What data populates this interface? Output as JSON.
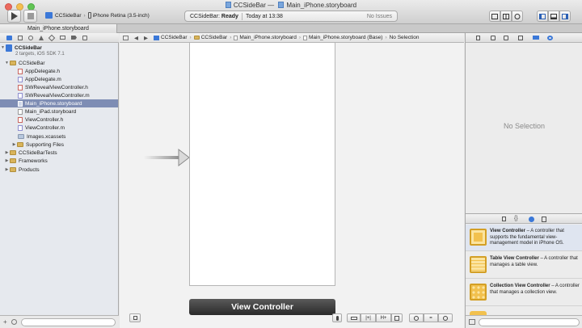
{
  "window": {
    "title_app": "CCSideBar",
    "title_sep": "—",
    "title_file": "Main_iPhone.storyboard",
    "tab": "Main_iPhone.storyboard"
  },
  "toolbar": {
    "scheme": "CCSideBar",
    "destination": "iPhone Retina (3.5-inch)",
    "status_app": "CCSideBar:",
    "status_state": "Ready",
    "status_time": "Today at 13:38",
    "status_issues": "No Issues"
  },
  "navigator": {
    "items": [
      {
        "label": "CCSideBar",
        "type": "project",
        "indent": 0
      },
      {
        "label": "2 targets, iOS SDK 7.1",
        "type": "subtitle",
        "indent": 0
      },
      {
        "label": "CCSideBar",
        "type": "folder-open",
        "indent": 1
      },
      {
        "label": "AppDelegate.h",
        "type": "file",
        "indent": 2
      },
      {
        "label": "AppDelegate.m",
        "type": "file",
        "indent": 2
      },
      {
        "label": "SWRevealViewController.h",
        "type": "file",
        "indent": 2
      },
      {
        "label": "SWRevealViewController.m",
        "type": "file",
        "indent": 2
      },
      {
        "label": "Main_iPhone.storyboard",
        "type": "file",
        "indent": 2,
        "selected": true
      },
      {
        "label": "Main_iPad.storyboard",
        "type": "file",
        "indent": 2
      },
      {
        "label": "ViewController.h",
        "type": "file",
        "indent": 2
      },
      {
        "label": "ViewController.m",
        "type": "file",
        "indent": 2
      },
      {
        "label": "Images.xcassets",
        "type": "file",
        "indent": 2
      },
      {
        "label": "Supporting Files",
        "type": "folder",
        "indent": 2
      },
      {
        "label": "CCSideBarTests",
        "type": "folder",
        "indent": 1
      },
      {
        "label": "Frameworks",
        "type": "folder",
        "indent": 1
      },
      {
        "label": "Products",
        "type": "folder",
        "indent": 1
      }
    ]
  },
  "jumpbar": {
    "crumbs": [
      "CCSideBar",
      "CCSideBar",
      "Main_iPhone.storyboard",
      "Main_iPhone.storyboard (Base)",
      "No Selection"
    ]
  },
  "canvas": {
    "scene_label": "View Controller"
  },
  "inspector": {
    "empty_text": "No Selection"
  },
  "library": {
    "items": [
      {
        "title": "View Controller",
        "desc": " – A controller that supports the fundamental view-management model in iPhone OS.",
        "color": "#f2c14e"
      },
      {
        "title": "Table View Controller",
        "desc": " – A controller that manages a table view.",
        "color": "#f2c14e"
      },
      {
        "title": "Collection View Controller",
        "desc": " – A controller that manages a collection view.",
        "color": "#f2c14e"
      }
    ]
  },
  "colors": {
    "selection": "#7e8db4",
    "scene_bar": "#3a3a3a",
    "accent_blue": "#3b78d8"
  }
}
